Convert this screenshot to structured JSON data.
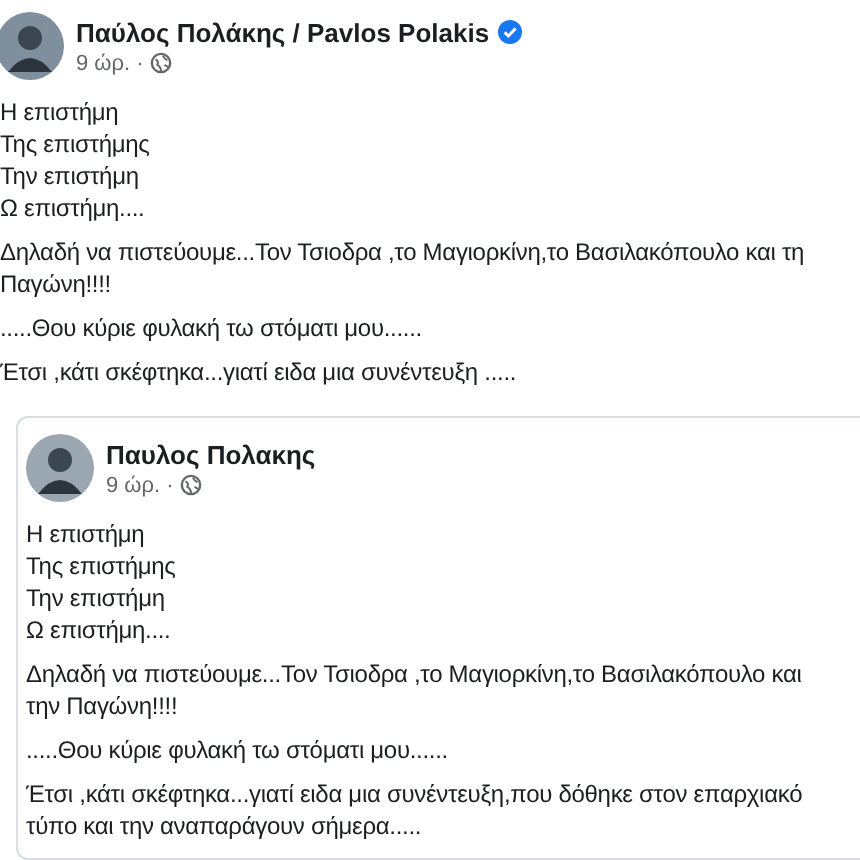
{
  "posts": [
    {
      "kind": "original",
      "author": "Παύλος Πολάκης / Pavlos Polakis",
      "verified": true,
      "time": "9 ώρ. ·",
      "paragraphs": [
        [
          "Η επιστήμη",
          "Της επιστήμης",
          "Την επιστήμη",
          "Ω επιστήμη...."
        ],
        [
          "Δηλαδή να πιστεύουμε...Τον Τσιοδρα ,το Μαγιορκίνη,το Βασιλακόπουλο και τη",
          "Παγώνη!!!!"
        ],
        [
          ".....Θου κύριε φυλακή τω στόματι μου......"
        ],
        [
          "Έτσι ,κάτι σκέφτηκα...γιατί ειδα μια συνέντευξη ....."
        ]
      ]
    },
    {
      "kind": "shared",
      "author": "Παυλος Πολακης",
      "verified": false,
      "time": "9 ώρ. ·",
      "paragraphs": [
        [
          "Η επιστήμη",
          "Της επιστήμης",
          "Την επιστήμη",
          "Ω επιστήμη...."
        ],
        [
          "Δηλαδή να πιστεύουμε...Τον Τσιοδρα ,το Μαγιορκίνη,το Βασιλακόπουλο και",
          "την Παγώνη!!!!"
        ],
        [
          ".....Θου κύριε φυλακή τω στόματι μου......"
        ],
        [
          "Έτσι ,κάτι σκέφτηκα...γιατί ειδα μια συνέντευξη,που δόθηκε στον επαρχιακό",
          "τύπο και την αναπαράγουν σήμερα....."
        ]
      ]
    }
  ]
}
